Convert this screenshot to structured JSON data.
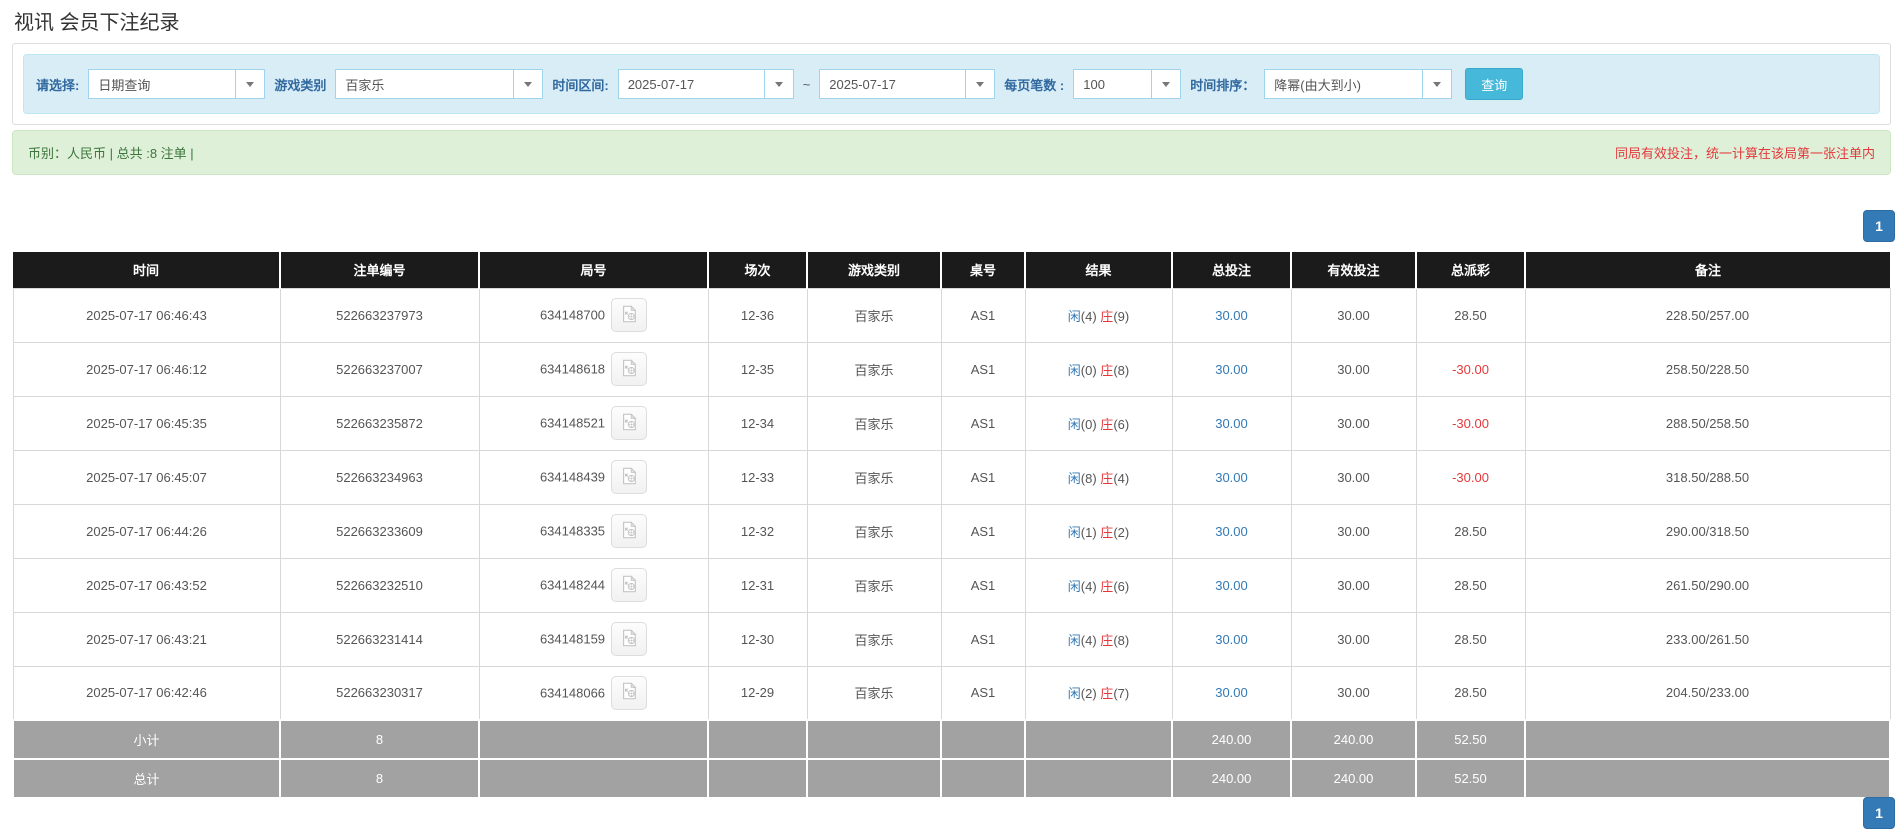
{
  "page": {
    "title": "视讯 会员下注纪录"
  },
  "filters": {
    "select_label": "请选择:",
    "select_value": "日期查询",
    "game_type_label": "游戏类别",
    "game_type_value": "百家乐",
    "time_range_label": "时间区间:",
    "date_from": "2025-07-17",
    "tilde": "~",
    "date_to": "2025-07-17",
    "page_size_label": "每页笔数 :",
    "page_size_value": "100",
    "sort_label": "时间排序：",
    "sort_value": "降幂(由大到小)",
    "search_button": "查询"
  },
  "summary": {
    "left": "币别：人民币 | 总共 :8 注单 |",
    "right_notice": "同局有效投注，统一计算在该局第一张注单内"
  },
  "pagination": {
    "page": "1"
  },
  "icons": {
    "dropdown": "caret-down-icon",
    "round_replay": "video-icon"
  },
  "colors": {
    "accent_blue": "#337ab7",
    "negative_red": "#e4393c",
    "header_black": "#1b1b1b",
    "summary_green_bg": "#dff0d8",
    "filter_blue_bg": "#d9edf7",
    "query_teal": "#46b8da",
    "subtotal_grey": "#a2a2a2"
  },
  "table": {
    "headers": [
      "时间",
      "注单编号",
      "局号",
      "场次",
      "游戏类别",
      "桌号",
      "结果",
      "总投注",
      "有效投注",
      "总派彩",
      "备注"
    ],
    "rows": [
      {
        "time": "2025-07-17 06:46:43",
        "bet_id": "522663237973",
        "round_id": "634148700",
        "session": "12-36",
        "game": "百家乐",
        "table_no": "AS1",
        "player": "闲(4)",
        "banker": "庄(9)",
        "total_bet": "30.00",
        "valid_bet": "30.00",
        "payout": "28.50",
        "remark": "228.50/257.00"
      },
      {
        "time": "2025-07-17 06:46:12",
        "bet_id": "522663237007",
        "round_id": "634148618",
        "session": "12-35",
        "game": "百家乐",
        "table_no": "AS1",
        "player": "闲(0)",
        "banker": "庄(8)",
        "total_bet": "30.00",
        "valid_bet": "30.00",
        "payout": "-30.00",
        "remark": "258.50/228.50"
      },
      {
        "time": "2025-07-17 06:45:35",
        "bet_id": "522663235872",
        "round_id": "634148521",
        "session": "12-34",
        "game": "百家乐",
        "table_no": "AS1",
        "player": "闲(0)",
        "banker": "庄(6)",
        "total_bet": "30.00",
        "valid_bet": "30.00",
        "payout": "-30.00",
        "remark": "288.50/258.50"
      },
      {
        "time": "2025-07-17 06:45:07",
        "bet_id": "522663234963",
        "round_id": "634148439",
        "session": "12-33",
        "game": "百家乐",
        "table_no": "AS1",
        "player": "闲(8)",
        "banker": "庄(4)",
        "total_bet": "30.00",
        "valid_bet": "30.00",
        "payout": "-30.00",
        "remark": "318.50/288.50"
      },
      {
        "time": "2025-07-17 06:44:26",
        "bet_id": "522663233609",
        "round_id": "634148335",
        "session": "12-32",
        "game": "百家乐",
        "table_no": "AS1",
        "player": "闲(1)",
        "banker": "庄(2)",
        "total_bet": "30.00",
        "valid_bet": "30.00",
        "payout": "28.50",
        "remark": "290.00/318.50"
      },
      {
        "time": "2025-07-17 06:43:52",
        "bet_id": "522663232510",
        "round_id": "634148244",
        "session": "12-31",
        "game": "百家乐",
        "table_no": "AS1",
        "player": "闲(4)",
        "banker": "庄(6)",
        "total_bet": "30.00",
        "valid_bet": "30.00",
        "payout": "28.50",
        "remark": "261.50/290.00"
      },
      {
        "time": "2025-07-17 06:43:21",
        "bet_id": "522663231414",
        "round_id": "634148159",
        "session": "12-30",
        "game": "百家乐",
        "table_no": "AS1",
        "player": "闲(4)",
        "banker": "庄(8)",
        "total_bet": "30.00",
        "valid_bet": "30.00",
        "payout": "28.50",
        "remark": "233.00/261.50"
      },
      {
        "time": "2025-07-17 06:42:46",
        "bet_id": "522663230317",
        "round_id": "634148066",
        "session": "12-29",
        "game": "百家乐",
        "table_no": "AS1",
        "player": "闲(2)",
        "banker": "庄(7)",
        "total_bet": "30.00",
        "valid_bet": "30.00",
        "payout": "28.50",
        "remark": "204.50/233.00"
      }
    ],
    "subtotal": {
      "label": "小计",
      "count": "8",
      "total_bet": "240.00",
      "valid_bet": "240.00",
      "payout": "52.50"
    },
    "total": {
      "label": "总计",
      "count": "8",
      "total_bet": "240.00",
      "valid_bet": "240.00",
      "payout": "52.50"
    }
  }
}
